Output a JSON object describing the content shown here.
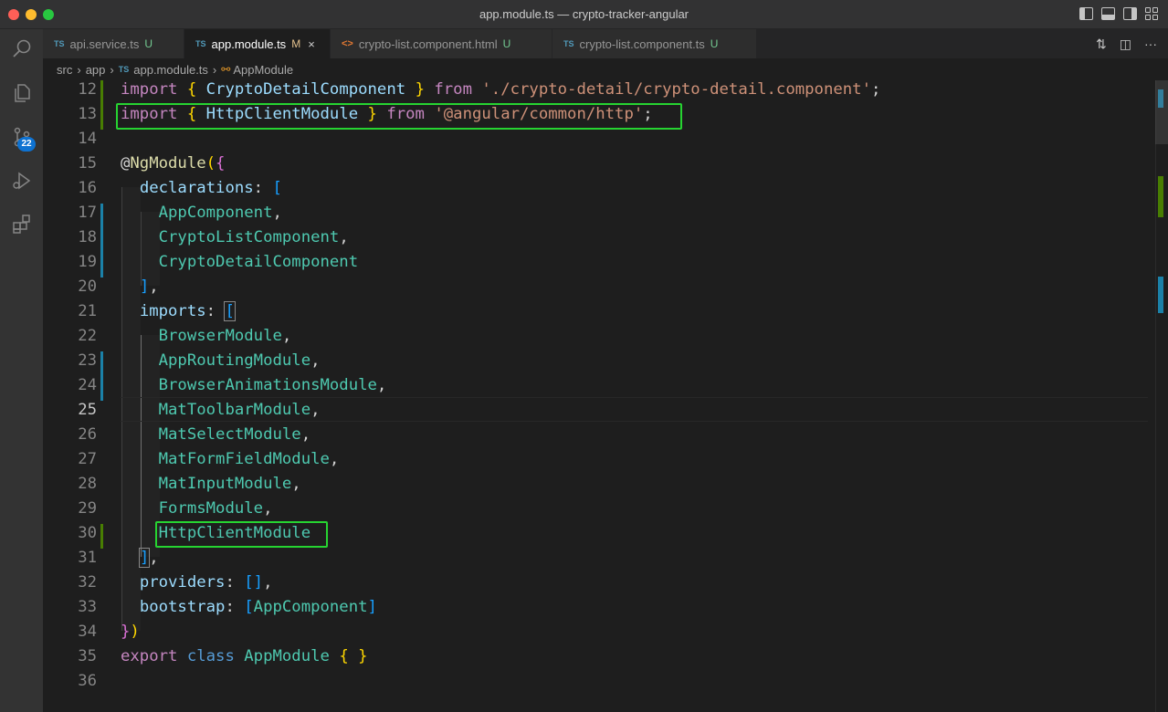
{
  "window": {
    "title": "app.module.ts — crypto-tracker-angular"
  },
  "tabs": [
    {
      "icon": "TS",
      "label": "api.service.ts",
      "status": "U",
      "active": false
    },
    {
      "icon": "TS",
      "label": "app.module.ts",
      "status": "M",
      "active": true,
      "close": "×"
    },
    {
      "icon": "<>",
      "label": "crypto-list.component.html",
      "status": "U",
      "active": false
    },
    {
      "icon": "TS",
      "label": "crypto-list.component.ts",
      "status": "U",
      "active": false
    }
  ],
  "tab_actions": [
    "compare-icon",
    "split-editor-icon",
    "more-icon"
  ],
  "tab_actions_glyphs": [
    "⇅",
    "◫",
    "···"
  ],
  "breadcrumb": {
    "items": [
      "src",
      "app",
      "app.module.ts",
      "AppModule"
    ],
    "ts_icon": "TS",
    "separator": "›"
  },
  "activity_bar": {
    "items": [
      "explorer-search-icon",
      "files-icon",
      "source-control-icon",
      "run-debug-icon",
      "extensions-icon"
    ],
    "scm_badge": "22"
  },
  "editor": {
    "current_line": 25,
    "lines": [
      {
        "n": "12"
      },
      {
        "n": "13"
      },
      {
        "n": "14"
      },
      {
        "n": "15"
      },
      {
        "n": "16"
      },
      {
        "n": "17"
      },
      {
        "n": "18"
      },
      {
        "n": "19"
      },
      {
        "n": "20"
      },
      {
        "n": "21"
      },
      {
        "n": "22"
      },
      {
        "n": "23"
      },
      {
        "n": "24"
      },
      {
        "n": "25"
      },
      {
        "n": "26"
      },
      {
        "n": "27"
      },
      {
        "n": "28"
      },
      {
        "n": "29"
      },
      {
        "n": "30"
      },
      {
        "n": "31"
      },
      {
        "n": "32"
      },
      {
        "n": "33"
      },
      {
        "n": "34"
      },
      {
        "n": "35"
      },
      {
        "n": "36"
      }
    ],
    "code": {
      "l12": {
        "kw": "import",
        "o": "{",
        "name": "CryptoDetailComponent",
        "c": "}",
        "from": "from",
        "path": "'./crypto-detail/crypto-detail.component'",
        "end": ";"
      },
      "l13": {
        "kw": "import",
        "o": "{",
        "name": "HttpClientModule",
        "c": "}",
        "from": "from",
        "path": "'@angular/common/http'",
        "end": ";"
      },
      "l15": {
        "at": "@",
        "dec": "NgModule",
        "p": "(",
        "o": "{"
      },
      "l16": {
        "key": "declarations",
        "colon": ":",
        "o": "["
      },
      "l17": {
        "name": "AppComponent",
        "comma": ","
      },
      "l18": {
        "name": "CryptoListComponent",
        "comma": ","
      },
      "l19": {
        "name": "CryptoDetailComponent"
      },
      "l20": {
        "c": "]",
        "comma": ","
      },
      "l21": {
        "key": "imports",
        "colon": ":",
        "o": "["
      },
      "l22": {
        "name": "BrowserModule",
        "comma": ","
      },
      "l23": {
        "name": "AppRoutingModule",
        "comma": ","
      },
      "l24": {
        "name": "BrowserAnimationsModule",
        "comma": ","
      },
      "l25": {
        "name": "MatToolbarModule",
        "comma": ","
      },
      "l26": {
        "name": "MatSelectModule",
        "comma": ","
      },
      "l27": {
        "name": "MatFormFieldModule",
        "comma": ","
      },
      "l28": {
        "name": "MatInputModule",
        "comma": ","
      },
      "l29": {
        "name": "FormsModule",
        "comma": ","
      },
      "l30": {
        "name": "HttpClientModule"
      },
      "l31": {
        "c": "]",
        "comma": ","
      },
      "l32": {
        "key": "providers",
        "colon": ":",
        "o": "[",
        "c": "]",
        "comma": ","
      },
      "l33": {
        "key": "bootstrap",
        "colon": ":",
        "o": "[",
        "name": "AppComponent",
        "c": "]"
      },
      "l34": {
        "c": "}",
        "p": ")"
      },
      "l35": {
        "kw": "export",
        "kw2": "class",
        "name": "AppModule",
        "o": "{",
        "c": "}"
      }
    }
  },
  "colors": {
    "highlight_box": "#26d431",
    "keyword": "#c586c0",
    "class": "#4ec9b0",
    "string": "#ce9178",
    "property": "#9cdcfe"
  }
}
